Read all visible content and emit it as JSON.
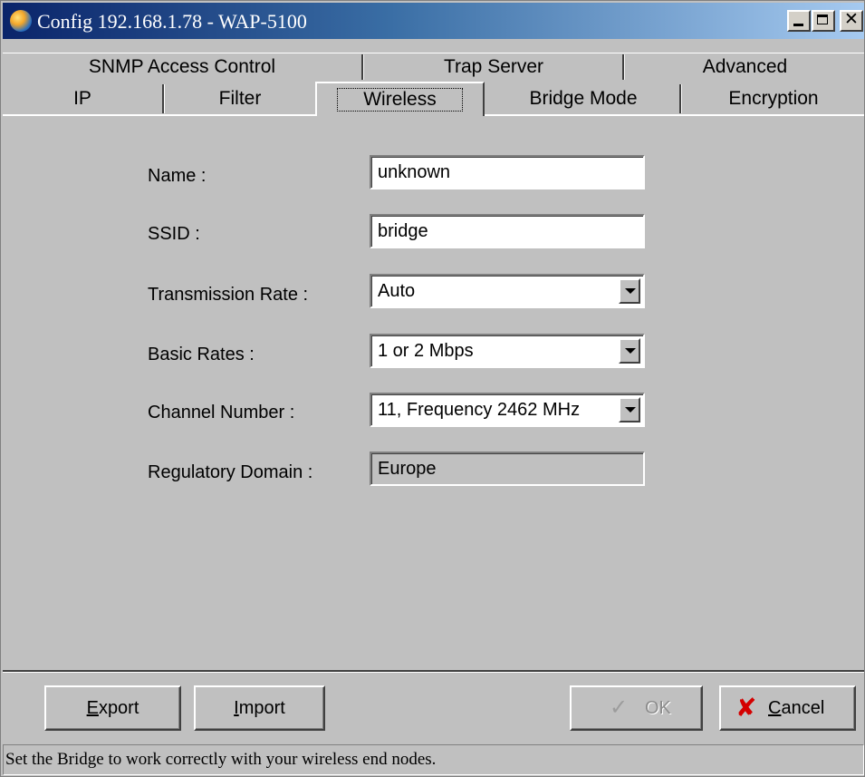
{
  "window": {
    "title": "Config 192.168.1.78 - WAP-5100"
  },
  "tabs": {
    "row1": [
      "SNMP Access Control",
      "Trap Server",
      "Advanced"
    ],
    "row2": [
      "IP",
      "Filter",
      "Wireless",
      "Bridge Mode",
      "Encryption"
    ],
    "active": "Wireless"
  },
  "form": {
    "name": {
      "label": "Name :",
      "value": "unknown"
    },
    "ssid": {
      "label": "SSID :",
      "value": "bridge"
    },
    "transmission_rate": {
      "label": "Transmission Rate :",
      "value": "Auto"
    },
    "basic_rates": {
      "label": "Basic Rates :",
      "value": "1 or 2 Mbps"
    },
    "channel_number": {
      "label": "Channel Number :",
      "value": "11, Frequency 2462 MHz"
    },
    "regulatory_domain": {
      "label": "Regulatory Domain :",
      "value": "Europe"
    }
  },
  "buttons": {
    "export": {
      "mnemonic": "E",
      "rest": "xport"
    },
    "import": {
      "mnemonic": "I",
      "rest": "mport"
    },
    "ok": "OK",
    "cancel": {
      "mnemonic": "C",
      "rest": "ancel"
    }
  },
  "status": "Set the Bridge to work correctly with your wireless end nodes.",
  "colors": {
    "titlebar_start": "#0a246a",
    "titlebar_end": "#a6caf0",
    "face": "#c0c0c0",
    "cancel_icon": "#d40000"
  },
  "icons": {
    "app": "globe-icon",
    "ok": "checkmark-icon",
    "cancel": "red-x-icon"
  }
}
